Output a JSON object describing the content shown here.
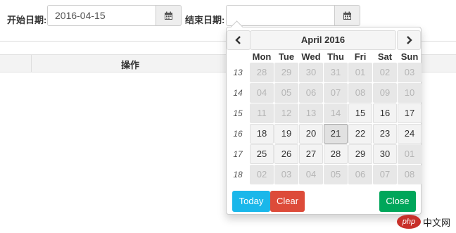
{
  "filters": {
    "start_label": "开始日期:",
    "start_value": "2016-04-15",
    "end_label": "结束日期:",
    "end_value": ""
  },
  "table": {
    "header_action": "操作"
  },
  "datepicker": {
    "title": "April 2016",
    "weekdays": [
      "Mon",
      "Tue",
      "Wed",
      "Thu",
      "Fri",
      "Sat",
      "Sun"
    ],
    "weeks": [
      {
        "num": "13",
        "days": [
          {
            "d": "28",
            "s": "disabled"
          },
          {
            "d": "29",
            "s": "disabled"
          },
          {
            "d": "30",
            "s": "disabled"
          },
          {
            "d": "31",
            "s": "disabled"
          },
          {
            "d": "01",
            "s": "disabled"
          },
          {
            "d": "02",
            "s": "disabled"
          },
          {
            "d": "03",
            "s": "disabled"
          }
        ]
      },
      {
        "num": "14",
        "days": [
          {
            "d": "04",
            "s": "disabled"
          },
          {
            "d": "05",
            "s": "disabled"
          },
          {
            "d": "06",
            "s": "disabled"
          },
          {
            "d": "07",
            "s": "disabled"
          },
          {
            "d": "08",
            "s": "disabled"
          },
          {
            "d": "09",
            "s": "disabled"
          },
          {
            "d": "10",
            "s": "disabled"
          }
        ]
      },
      {
        "num": "15",
        "days": [
          {
            "d": "11",
            "s": "disabled"
          },
          {
            "d": "12",
            "s": "disabled"
          },
          {
            "d": "13",
            "s": "disabled"
          },
          {
            "d": "14",
            "s": "disabled"
          },
          {
            "d": "15",
            "s": "enabled"
          },
          {
            "d": "16",
            "s": "enabled"
          },
          {
            "d": "17",
            "s": "enabled"
          }
        ]
      },
      {
        "num": "16",
        "days": [
          {
            "d": "18",
            "s": "enabled"
          },
          {
            "d": "19",
            "s": "enabled"
          },
          {
            "d": "20",
            "s": "enabled"
          },
          {
            "d": "21",
            "s": "today"
          },
          {
            "d": "22",
            "s": "enabled"
          },
          {
            "d": "23",
            "s": "enabled"
          },
          {
            "d": "24",
            "s": "enabled"
          }
        ]
      },
      {
        "num": "17",
        "days": [
          {
            "d": "25",
            "s": "enabled"
          },
          {
            "d": "26",
            "s": "enabled"
          },
          {
            "d": "27",
            "s": "enabled"
          },
          {
            "d": "28",
            "s": "enabled"
          },
          {
            "d": "29",
            "s": "enabled"
          },
          {
            "d": "30",
            "s": "enabled"
          },
          {
            "d": "01",
            "s": "disabled"
          }
        ]
      },
      {
        "num": "18",
        "days": [
          {
            "d": "02",
            "s": "disabled"
          },
          {
            "d": "03",
            "s": "disabled"
          },
          {
            "d": "04",
            "s": "disabled"
          },
          {
            "d": "05",
            "s": "disabled"
          },
          {
            "d": "06",
            "s": "disabled"
          },
          {
            "d": "07",
            "s": "disabled"
          },
          {
            "d": "08",
            "s": "disabled"
          }
        ]
      }
    ],
    "today_label": "Today",
    "clear_label": "Clear",
    "close_label": "Close"
  },
  "colors": {
    "today_button": "#1ab7ea",
    "clear_button": "#dd4b39",
    "close_button": "#00a65a",
    "watermark": "#c8302a"
  },
  "icons": {
    "calendar": "calendar-icon",
    "prev": "chevron-left-icon",
    "next": "chevron-right-icon"
  },
  "watermark": {
    "logo": "php",
    "text": "中文网"
  }
}
